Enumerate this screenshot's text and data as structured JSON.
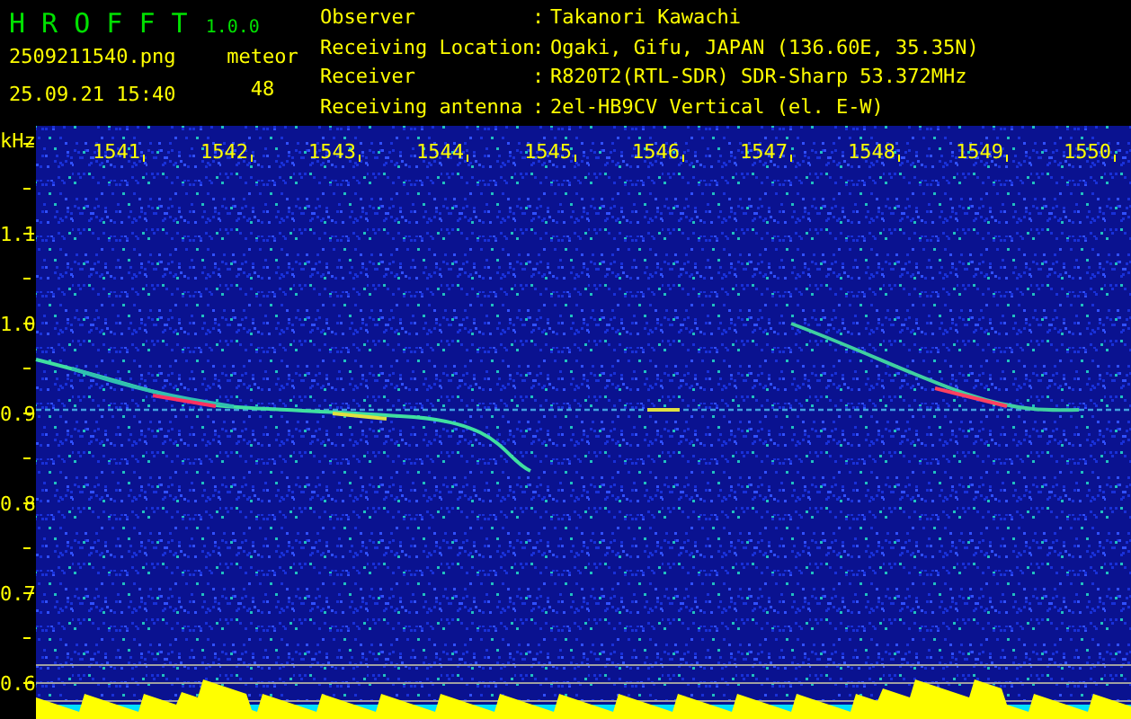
{
  "app": {
    "name": "H R O F F T",
    "version": "1.0.0"
  },
  "file_name": "2509211540.png",
  "timestamp": "25.09.21 15:40",
  "meteor": {
    "label": "meteor",
    "count": "48"
  },
  "info": [
    {
      "label": "Observer",
      "separator": ":",
      "value": "Takanori Kawachi"
    },
    {
      "label": "Receiving Location",
      "separator": ":",
      "value": "Ogaki, Gifu, JAPAN (136.60E, 35.35N)"
    },
    {
      "label": "Receiver",
      "separator": ":",
      "value": "R820T2(RTL-SDR) SDR-Sharp 53.372MHz"
    },
    {
      "label": "Receiving antenna",
      "separator": ":",
      "value": "2el-HB9CV Vertical (el. E-W)"
    }
  ],
  "y_axis": {
    "unit": "kHz",
    "labels": [
      "1.1",
      "1.0",
      "0.9",
      "0.8",
      "0.7",
      "0.6"
    ]
  },
  "x_axis": {
    "labels": [
      "1541",
      "1542",
      "1543",
      "1544",
      "1545",
      "1546",
      "1547",
      "1548",
      "1549",
      "1550"
    ]
  }
}
